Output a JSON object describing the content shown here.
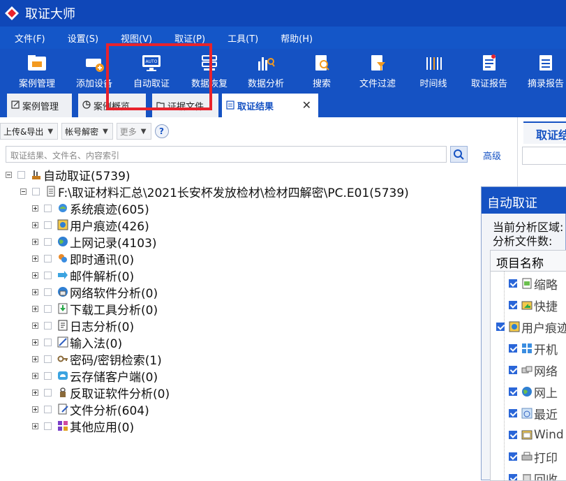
{
  "app": {
    "title": "取证大师"
  },
  "menu": [
    "文件(F)",
    "设置(S)",
    "视图(V)",
    "取证(P)",
    "工具(T)",
    "帮助(H)"
  ],
  "toolbar": [
    {
      "label": "案例管理",
      "icon": "case-folder-icon"
    },
    {
      "label": "添加设备",
      "icon": "add-device-icon"
    },
    {
      "label": "自动取证",
      "icon": "auto-monitor-icon"
    },
    {
      "label": "数据恢复",
      "icon": "data-recovery-icon"
    },
    {
      "label": "数据分析",
      "icon": "data-analysis-icon"
    },
    {
      "label": "搜索",
      "icon": "search-document-icon"
    },
    {
      "label": "文件过滤",
      "icon": "file-filter-icon"
    },
    {
      "label": "时间线",
      "icon": "timeline-icon"
    },
    {
      "label": "取证报告",
      "icon": "report-icon"
    },
    {
      "label": "摘录报告",
      "icon": "excerpt-report-icon"
    }
  ],
  "tabs": [
    {
      "label": "案例管理",
      "active": false
    },
    {
      "label": "案例概览",
      "active": false
    },
    {
      "label": "证据文件",
      "active": false
    },
    {
      "label": "取证结果",
      "active": true
    }
  ],
  "subtoolbar": {
    "upload": "上传&导出",
    "account": "帐号解密",
    "more": "更多",
    "help": "?"
  },
  "search": {
    "placeholder": "取证结果、文件名、内容索引",
    "advanced": "高级"
  },
  "tree": {
    "root": "自动取证(5739)",
    "evidence": "F:\\取证材料汇总\\2021长安杯发放检材\\检材四解密\\PC.E01(5739)",
    "items": [
      {
        "label": "系统痕迹(605)",
        "icon": "system-trace-icon"
      },
      {
        "label": "用户痕迹(426)",
        "icon": "user-trace-icon"
      },
      {
        "label": "上网记录(4103)",
        "icon": "globe-icon"
      },
      {
        "label": "即时通讯(0)",
        "icon": "chat-icon"
      },
      {
        "label": "邮件解析(0)",
        "icon": "mail-icon"
      },
      {
        "label": "网络软件分析(0)",
        "icon": "network-software-icon"
      },
      {
        "label": "下载工具分析(0)",
        "icon": "download-icon"
      },
      {
        "label": "日志分析(0)",
        "icon": "log-icon"
      },
      {
        "label": "输入法(0)",
        "icon": "input-method-icon"
      },
      {
        "label": "密码/密钥检索(1)",
        "icon": "key-icon"
      },
      {
        "label": "云存储客户端(0)",
        "icon": "cloud-icon"
      },
      {
        "label": "反取证软件分析(0)",
        "icon": "anti-forensics-icon"
      },
      {
        "label": "文件分析(604)",
        "icon": "file-analysis-icon"
      },
      {
        "label": "其他应用(0)",
        "icon": "apps-icon"
      }
    ]
  },
  "right_pane": {
    "tab": "取证结"
  },
  "dialog": {
    "title": "自动取证",
    "area_label": "当前分析区域:",
    "files_label": "分析文件数:",
    "column": "项目名称",
    "rows": [
      {
        "label": "缩略",
        "indent": 1
      },
      {
        "label": "快捷",
        "indent": 1
      },
      {
        "label": "用户痕迹",
        "indent": 0
      },
      {
        "label": "开机",
        "indent": 1
      },
      {
        "label": "网络",
        "indent": 1
      },
      {
        "label": "网上",
        "indent": 1
      },
      {
        "label": "最近",
        "indent": 1
      },
      {
        "label": "Wind",
        "indent": 1
      },
      {
        "label": "打印",
        "indent": 1
      },
      {
        "label": "回收",
        "indent": 1
      }
    ]
  },
  "colors": {
    "titlebar": "#0f47b8",
    "toolbar": "#1552c3",
    "highlight": "#e8232c"
  }
}
